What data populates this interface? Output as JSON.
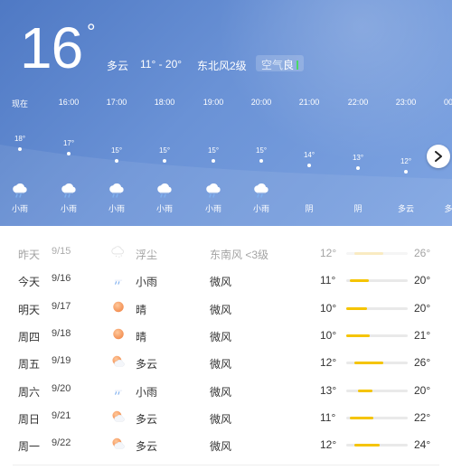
{
  "current": {
    "temp": "16",
    "deg": "°",
    "condition": "多云",
    "range": "11° - 20°",
    "wind": "东北风2级",
    "aqi_label": "空气",
    "aqi_value": "良"
  },
  "hourly": [
    {
      "time": "现在",
      "temp": "18°",
      "cond": "小雨",
      "icon": "rain-cloud-icon"
    },
    {
      "time": "16:00",
      "temp": "17°",
      "cond": "小雨",
      "icon": "rain-cloud-icon"
    },
    {
      "time": "17:00",
      "temp": "15°",
      "cond": "小雨",
      "icon": "rain-cloud-icon"
    },
    {
      "time": "18:00",
      "temp": "15°",
      "cond": "小雨",
      "icon": "rain-cloud-icon"
    },
    {
      "time": "19:00",
      "temp": "15°",
      "cond": "小雨",
      "icon": "rain-cloud-icon"
    },
    {
      "time": "20:00",
      "temp": "15°",
      "cond": "小雨",
      "icon": "rain-cloud-icon"
    },
    {
      "time": "21:00",
      "temp": "14°",
      "cond": "阴",
      "icon": "none"
    },
    {
      "time": "22:00",
      "temp": "13°",
      "cond": "阴",
      "icon": "none"
    },
    {
      "time": "23:00",
      "temp": "12°",
      "cond": "多云",
      "icon": "none"
    },
    {
      "time": "00",
      "temp": "",
      "cond": "多",
      "icon": "none"
    }
  ],
  "daily": [
    {
      "name": "昨天",
      "date": "9/15",
      "cond": "浮尘",
      "icon": "dust-icon",
      "wind": "东南风 <3级",
      "low": "12°",
      "high": "26°",
      "low_v": 12,
      "high_v": 26,
      "past": true
    },
    {
      "name": "今天",
      "date": "9/16",
      "cond": "小雨",
      "icon": "rain-cloud-icon",
      "wind": "微风",
      "low": "11°",
      "high": "20°",
      "low_v": 11,
      "high_v": 20,
      "past": false
    },
    {
      "name": "明天",
      "date": "9/17",
      "cond": "晴",
      "icon": "sun-icon",
      "wind": "微风",
      "low": "10°",
      "high": "20°",
      "low_v": 10,
      "high_v": 20,
      "past": false
    },
    {
      "name": "周四",
      "date": "9/18",
      "cond": "晴",
      "icon": "sun-icon",
      "wind": "微风",
      "low": "10°",
      "high": "21°",
      "low_v": 10,
      "high_v": 21,
      "past": false
    },
    {
      "name": "周五",
      "date": "9/19",
      "cond": "多云",
      "icon": "partly-cloudy-icon",
      "wind": "微风",
      "low": "12°",
      "high": "26°",
      "low_v": 12,
      "high_v": 26,
      "past": false
    },
    {
      "name": "周六",
      "date": "9/20",
      "cond": "小雨",
      "icon": "rain-cloud-icon",
      "wind": "微风",
      "low": "13°",
      "high": "20°",
      "low_v": 13,
      "high_v": 20,
      "past": false
    },
    {
      "name": "周日",
      "date": "9/21",
      "cond": "多云",
      "icon": "partly-cloudy-icon",
      "wind": "微风",
      "low": "11°",
      "high": "22°",
      "low_v": 11,
      "high_v": 22,
      "past": false
    },
    {
      "name": "周一",
      "date": "9/22",
      "cond": "多云",
      "icon": "partly-cloudy-icon",
      "wind": "微风",
      "low": "12°",
      "high": "24°",
      "low_v": 12,
      "high_v": 24,
      "past": false
    }
  ],
  "range_scale": {
    "min": 10,
    "max": 26
  },
  "colors": {
    "accent_bar": "#f5c400",
    "aqi_good": "#4cd964",
    "hero_bg": "#5f87cf"
  }
}
